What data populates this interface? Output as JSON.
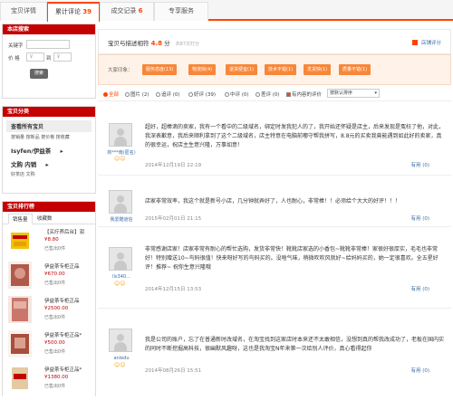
{
  "tabs": [
    {
      "label": "宝贝详情",
      "count": ""
    },
    {
      "label": "累计评论",
      "count": "39"
    },
    {
      "label": "成交记录",
      "count": "6"
    },
    {
      "label": "专享服务",
      "count": ""
    }
  ],
  "sidebar": {
    "search": {
      "title": "本店搜索",
      "keyword_label": "关键字",
      "price_label": "价 格",
      "price_sep": "到",
      "price_placeholder": "￥",
      "button": "搜索"
    },
    "categories": {
      "title": "宝贝分类",
      "all": "查看所有宝贝",
      "sort_line": "按销量 按新品 按价格 按收藏",
      "group1": "Isyfen/伊益茶",
      "group2": "文购 内销",
      "group2_line": "好茶店 文购",
      "arrow": "▸"
    },
    "ranking": {
      "title": "宝贝排行榜",
      "tab_sales": "销售量",
      "tab_fav": "收藏数",
      "items": [
        {
          "name": "【买疗养后台】润",
          "price": "¥8.80",
          "sold": "已售出0件"
        },
        {
          "name": "伊益茶专柜正品",
          "price": "¥670.00",
          "sold": "已售出0件"
        },
        {
          "name": "伊益茶专柜正品",
          "price": "¥2500.00",
          "sold": "已售出0件"
        },
        {
          "name": "伊益茶专柜正品*",
          "price": "¥500.00",
          "sold": "已售出0件"
        },
        {
          "name": "伊益茶专柜正品*",
          "price": "¥1380.00",
          "sold": "已售出0件"
        }
      ]
    }
  },
  "summary": {
    "label": "宝贝与描述相符",
    "score": "4.8",
    "unit": "分",
    "muted": "共87次打分",
    "link": "店铺评分"
  },
  "impressions": {
    "label": "大家印象：",
    "tags": [
      "服务态度(13)",
      "物流快(4)",
      "退货便宜(1)",
      "技术不错(1)",
      "发货快(1)",
      "质量不错(1)"
    ]
  },
  "filter": {
    "options": [
      "全部",
      "图片 (2)",
      "追评 (0)",
      "好评 (39)",
      "中评 (0)",
      "差评 (0)"
    ],
    "with_content": "有内容的评价",
    "sort": "按默认排序"
  },
  "reviews": [
    {
      "user": "商***南(匿名)",
      "badge": "☺☺",
      "text": "超好，超棒滴的卖家，我有一个看中的二级域名，绑定时发我犯人的了，我开始还怀疑是店主，后来发现是冤枉了他，对此，我深表歉意，我后来顺利拿到了这个二级域名，店主特意在电脑前嘟守帮我拼写，8.8元的买卖我竟能遇到如此好的卖家，真的很幸运，祝店主生意兴隆，万事如意！",
      "date": "2014年12月19日 22:19",
      "useful": "有用 (0)"
    },
    {
      "user": "我爱酷道信",
      "badge": "",
      "text": "店家非常效率，我这个就是新号小店，几分钟就弄好了，人也耐心，非常棒！！必须给个大大的好评！！！",
      "date": "2015年02月01日 21:15",
      "useful": "有用 (0)"
    },
    {
      "user": "lls340...",
      "badge": "☺☺",
      "text": "非常感谢店家！店家非常有耐心的帮忙选购，发货非常快！靴靴店家选的小香包~靴靴非常棒！家很好很厚实，毛毛也非常好！特别赠送10~鸟码很值！快来呀好写的鸟码买的。没啥气味，稍微吹吹风就好~给妈妈买的，她一定很喜欢。全五星好评！推荐~ 祝你生意兴隆哦",
      "date": "2014年12月15日 13:53",
      "useful": "有用 (0)"
    },
    {
      "user": "anledu",
      "badge": "☺☺",
      "text": "我是公司的账户，忘了在普通新时改域名，在淘宝找到这家店时本来还不太敢相信，没想到真的帮我改成功了，老板在国内实的同时不断挖掘高科技，很幽默风趣呀，这也是我淘宝N年来第一次给别人评价，真心看得起你",
      "date": "2014年08月26日 15:51",
      "useful": "有用 (0)"
    }
  ],
  "colors": {
    "accent": "#ff4400",
    "sidebar_head": "#c40000",
    "impress_tag": "#f7873a",
    "impress_bg": "#fff2e8",
    "link": "#3a6ea5"
  }
}
